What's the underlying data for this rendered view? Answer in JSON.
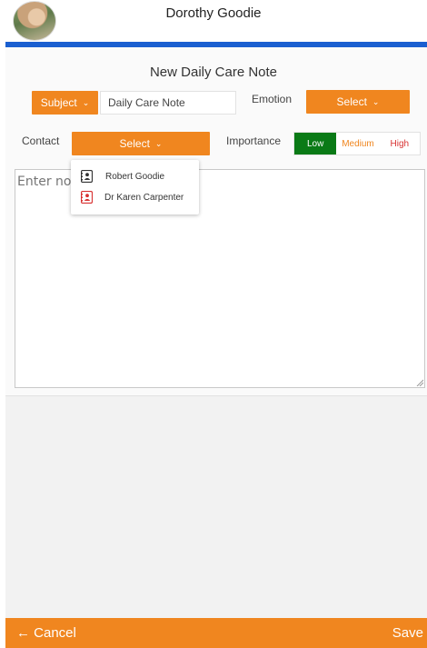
{
  "header": {
    "title": "Dorothy Goodie"
  },
  "form": {
    "title": "New Daily Care Note",
    "subject": {
      "button_label": "Subject",
      "value": "Daily Care Note"
    },
    "emotion": {
      "label": "Emotion",
      "button_label": "Select"
    },
    "contact": {
      "label": "Contact",
      "button_label": "Select"
    },
    "importance": {
      "label": "Importance",
      "options": [
        "Low",
        "Medium",
        "High"
      ],
      "selected": "Low"
    },
    "notes": {
      "placeholder": "Enter notes"
    }
  },
  "contact_dropdown": {
    "items": [
      {
        "name": "Robert Goodie",
        "icon": "contact-card-icon",
        "color": "#333333"
      },
      {
        "name": "Dr Karen Carpenter",
        "icon": "contact-card-icon",
        "color": "#d83232"
      }
    ]
  },
  "footer": {
    "cancel_label": "← Cancel",
    "save_label": "Save"
  },
  "colors": {
    "accent": "#f0861f",
    "header_bar": "#1a5fd0",
    "importance_low": "#0a7a16",
    "importance_high": "#d83232"
  }
}
